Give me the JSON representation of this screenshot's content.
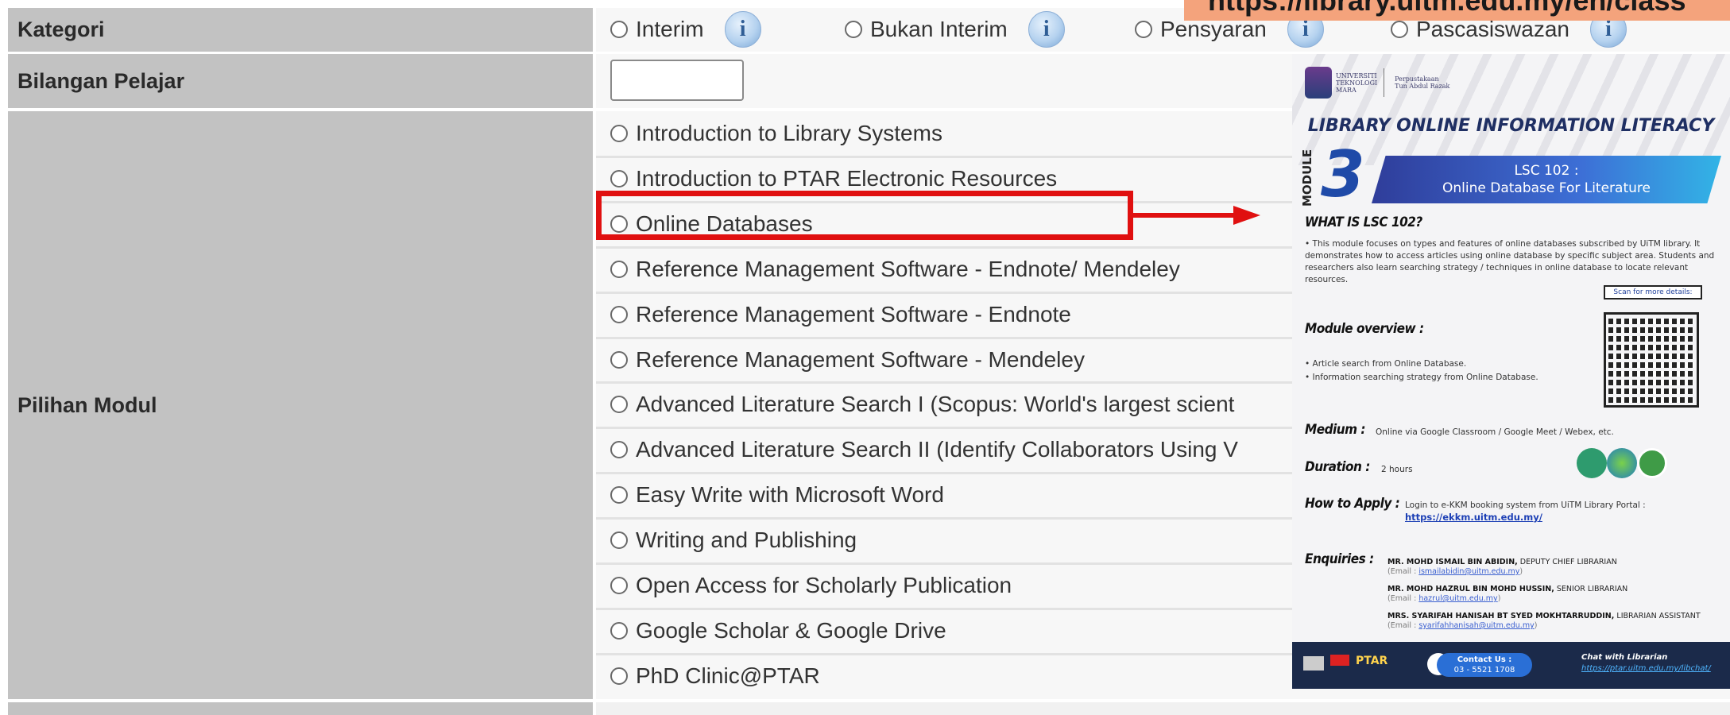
{
  "banner": {
    "url_text": "https://library.uitm.edu.my/en/class"
  },
  "form": {
    "kategori": {
      "label": "Kategori",
      "options": [
        "Interim",
        "Bukan Interim",
        "Pensyaran",
        "Pascasiswazan"
      ],
      "info_glyph": "i"
    },
    "bilangan": {
      "label": "Bilangan Pelajar",
      "value": ""
    },
    "modul": {
      "label": "Pilihan Modul",
      "options": [
        "Introduction to Library Systems",
        "Introduction to PTAR Electronic Resources",
        "Online Databases",
        "Reference Management Software - Endnote/ Mendeley",
        "Reference Management Software - Endnote",
        "Reference Management Software - Mendeley",
        "Advanced Literature Search I (Scopus: World's largest scient",
        "Advanced Literature Search II (Identify Collaborators Using V",
        "Easy Write with Microsoft Word",
        "Writing and Publishing",
        "Open Access for Scholarly Publication",
        "Google Scholar & Google Drive",
        "PhD Clinic@PTAR"
      ]
    }
  },
  "annotation": {
    "highlight_color": "#e01010"
  },
  "poster": {
    "logo_uni": [
      "UNIVERSITI",
      "TEKNOLOGI",
      "MARA"
    ],
    "logo_lib": [
      "Perpustakaan",
      "Tun Abdul Razak"
    ],
    "title": "LIBRARY ONLINE INFORMATION LITERACY",
    "module_word": "MODULE",
    "module_num": "3",
    "banner_line1": "LSC 102 :",
    "banner_line2": "Online Database For Literature",
    "what_head": "WHAT IS LSC 102?",
    "what_text": "• This module focuses on types and features of online databases subscribed by UiTM library. It demonstrates how to access articles using online database by specific subject area. Students and researchers also learn searching strategy / techniques in online database to locate relevant resources.",
    "overview_head": "Module overview :",
    "overview_1": "• Article search from Online Database.",
    "overview_2": "• Information searching strategy from Online Database.",
    "scan_label": "Scan for more details:",
    "medium_head": "Medium :",
    "medium_text": "Online via Google Classroom / Google Meet / Webex, etc.",
    "duration_head": "Duration :",
    "duration_text": "2 hours",
    "apply_head": "How to Apply :",
    "apply_text": "Login to e-KKM booking system from UiTM Library Portal :",
    "apply_link": "https://ekkm.uitm.edu.my/",
    "enquiries_head": "Enquiries :",
    "contacts": [
      {
        "name": "MR. MOHD ISMAIL BIN ABIDIN,",
        "role": "DEPUTY CHIEF LIBRARIAN",
        "email_label": "(Email :",
        "email": "ismailabidin@uitm.edu.my",
        "close": ")"
      },
      {
        "name": "MR. MOHD HAZRUL BIN MOHD HUSSIN,",
        "role": "SENIOR LIBRARIAN",
        "email_label": "(Email :",
        "email": "hazrul@uitm.edu.my",
        "close": ")"
      },
      {
        "name": "MRS. SYARIFAH HANISAH BT SYED MOKHTARRUDDIN,",
        "role": "LIBRARIAN ASSISTANT",
        "email_label": "(Email :",
        "email": "syarifahhanisah@uitm.edu.my",
        "close": ")"
      }
    ],
    "footer_brand": "PTAR",
    "contact_label": "Contact Us :",
    "contact_phone": "03 - 5521 1708",
    "chat_label": "Chat with Librarian",
    "chat_link": "https://ptar.uitm.edu.my/libchat/"
  }
}
